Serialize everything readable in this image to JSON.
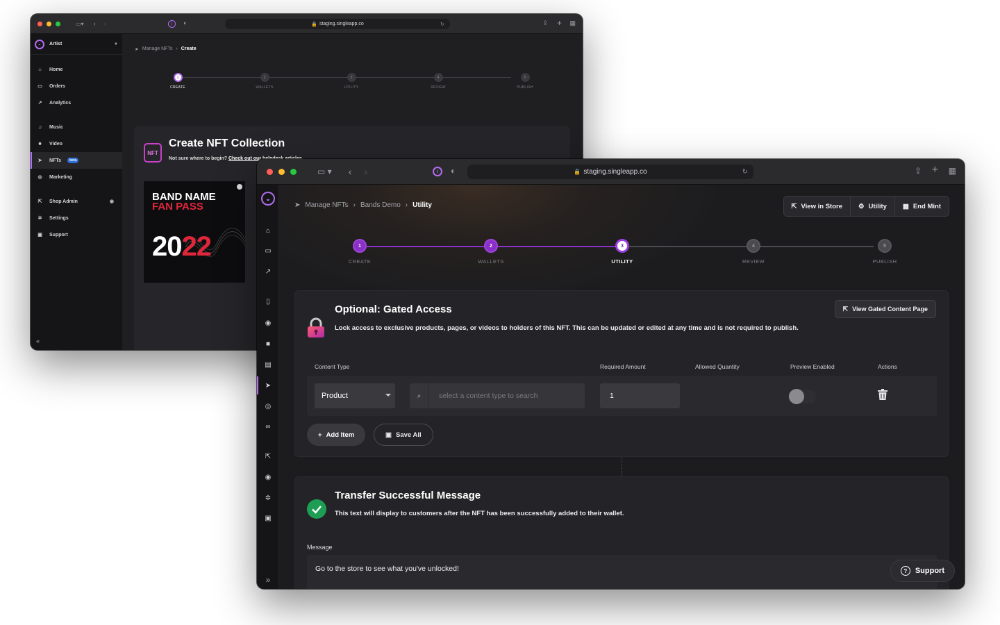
{
  "back_window": {
    "url": "staging.singleapp.co",
    "account": {
      "name": "Artist"
    },
    "nav": [
      {
        "label": "Home",
        "icon": "home-icon"
      },
      {
        "label": "Orders",
        "icon": "inbox-icon"
      },
      {
        "label": "Analytics",
        "icon": "chart-icon"
      },
      {
        "label": "Music",
        "icon": "music-file-icon"
      },
      {
        "label": "Video",
        "icon": "video-icon"
      },
      {
        "label": "NFTs",
        "icon": "rocket-icon",
        "badge": "beta"
      },
      {
        "label": "Marketing",
        "icon": "target-icon"
      },
      {
        "label": "Shop Admin",
        "icon": "external-link-icon"
      },
      {
        "label": "Settings",
        "icon": "gear-icon"
      },
      {
        "label": "Support",
        "icon": "briefcase-icon"
      }
    ],
    "breadcrumb": {
      "parent": "Manage NFTs",
      "current": "Create"
    },
    "steps": [
      {
        "num": "1",
        "label": "CREATE"
      },
      {
        "num": "2",
        "label": "WALLETS"
      },
      {
        "num": "3",
        "label": "UTILITY"
      },
      {
        "num": "4",
        "label": "REVIEW"
      },
      {
        "num": "5",
        "label": "PUBLISH"
      }
    ],
    "current_step": 1,
    "create": {
      "title": "Create NFT Collection",
      "help_prefix": "Not sure where to begin?",
      "help_link": "Check out our helpdesk articles.",
      "nft_icon_text": "NFT"
    },
    "fan_pass": {
      "line1": "BAND NAME",
      "line2": "FAN PASS",
      "year_a": "20",
      "year_b": "22"
    }
  },
  "front_window": {
    "url": "staging.singleapp.co",
    "breadcrumb": {
      "a": "Manage NFTs",
      "b": "Bands Demo",
      "current": "Utility"
    },
    "top_buttons": {
      "view_store": "View in Store",
      "utility": "Utility",
      "end_mint": "End Mint"
    },
    "steps": [
      {
        "num": "1",
        "label": "CREATE"
      },
      {
        "num": "2",
        "label": "WALLETS"
      },
      {
        "num": "3",
        "label": "UTILITY"
      },
      {
        "num": "4",
        "label": "REVIEW"
      },
      {
        "num": "5",
        "label": "PUBLISH"
      }
    ],
    "current_step": 3,
    "gated": {
      "title": "Optional: Gated Access",
      "description": "Lock access to exclusive products, pages, or videos to holders of this NFT. This can be updated or edited at any time and is not required to publish.",
      "view_button": "View Gated Content Page",
      "columns": {
        "content_type": "Content Type",
        "required_amount": "Required Amount",
        "allowed_quantity": "Allowed Quantity",
        "preview_enabled": "Preview Enabled",
        "actions": "Actions"
      },
      "row": {
        "content_type": "Product",
        "search_placeholder": "select a content type to search",
        "required_amount": "1",
        "preview_enabled": false
      },
      "add_item": "Add Item",
      "save_all": "Save All"
    },
    "transfer": {
      "title": "Transfer Successful Message",
      "description": "This text will display to customers after the NFT has been successfully added to their wallet.",
      "message_label": "Message",
      "message_value": "Go to the store to see what you've unlocked!"
    },
    "support_label": "Support"
  },
  "colors": {
    "accent_purple": "#9b3ee0",
    "success_green": "#1e9e55",
    "lock_pink": "#d6336c",
    "fan_red": "#e0263a"
  }
}
